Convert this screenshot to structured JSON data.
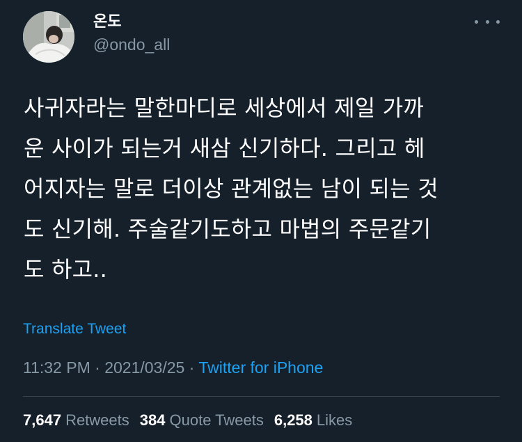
{
  "author": {
    "display_name": "온도",
    "handle": "@ondo_all"
  },
  "tweet": {
    "lines": [
      "사귀자라는 말한마디로 세상에서 제일 가까",
      "운 사이가 되는거 새삼 신기하다. 그리고 헤",
      "어지자는 말로 더이상 관계없는 남이 되는 것",
      "도 신기해. 주술같기도하고 마법의 주문같기",
      "도 하고.."
    ],
    "translate_label": "Translate Tweet",
    "time": "11:32 PM",
    "date": "2021/03/25",
    "separator": "·",
    "source": "Twitter for iPhone"
  },
  "stats": {
    "retweets": {
      "count": "7,647",
      "label": "Retweets"
    },
    "quote_tweets": {
      "count": "384",
      "label": "Quote Tweets"
    },
    "likes": {
      "count": "6,258",
      "label": "Likes"
    }
  },
  "icons": {
    "more": "more-horizontal-icon"
  },
  "colors": {
    "background": "#15202b",
    "text_primary": "#ffffff",
    "text_secondary": "#8899a6",
    "accent": "#1da1f2",
    "divider": "#38444d"
  }
}
